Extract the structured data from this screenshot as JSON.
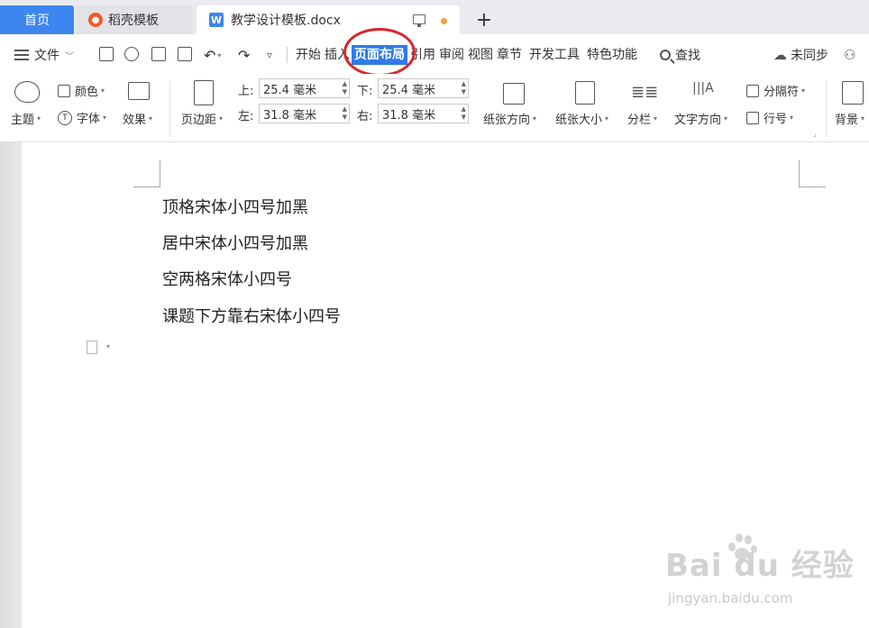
{
  "tabs": {
    "home": "首页",
    "template": "稻壳模板",
    "document": "教学设计模板.docx",
    "new_tab": "+"
  },
  "menu": {
    "file": "文件",
    "tabs": [
      "开始",
      "插入",
      "页面布局",
      "引用",
      "审阅",
      "视图",
      "章节",
      "开发工具",
      "特色功能"
    ],
    "active_tab": "页面布局",
    "search": "查找",
    "sync": "未同步"
  },
  "ribbon": {
    "theme": "主题",
    "color": "颜色",
    "font": "字体",
    "effect": "效果",
    "margins": "页边距",
    "top_label": "上:",
    "top_value": "25.4 毫米",
    "bottom_label": "下:",
    "bottom_value": "25.4 毫米",
    "left_label": "左:",
    "left_value": "31.8 毫米",
    "right_label": "右:",
    "right_value": "31.8 毫米",
    "orientation": "纸张方向",
    "size": "纸张大小",
    "columns": "分栏",
    "text_direction": "文字方向",
    "breaks": "分隔符",
    "line_numbers": "行号",
    "background": "背景"
  },
  "document": {
    "paragraphs": [
      "顶格宋体小四号加黑",
      "居中宋体小四号加黑",
      "空两格宋体小四号",
      "课题下方靠右宋体小四号"
    ]
  },
  "watermark": {
    "brand": "Bai du 经验",
    "url": "jingyan.baidu.com"
  },
  "colors": {
    "accent": "#3d86f0",
    "active_tab_bg": "#2f7be8",
    "annotation_circle": "#d9262b"
  }
}
